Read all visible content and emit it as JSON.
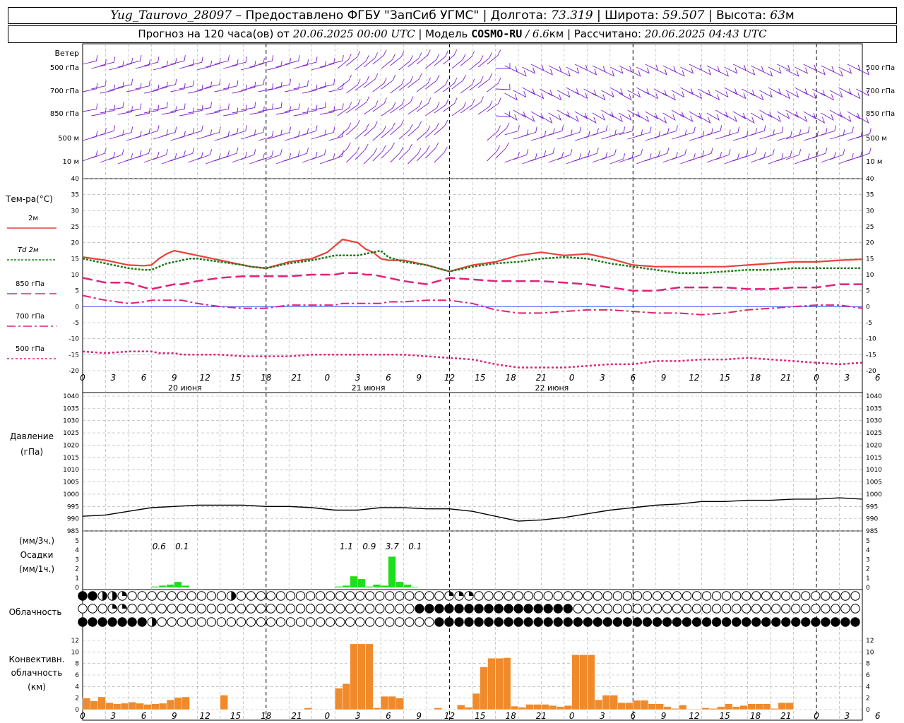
{
  "header": {
    "station": "Yug_Taurovo_28097",
    "provider": " – Предоставлено ФГБУ \"ЗапСиб УГМС\" | ",
    "lon_label": "Долгота: ",
    "lon": "73.319",
    "lat_label": " | Широта: ",
    "lat": "59.507",
    "alt_label": " | Высота: ",
    "alt": "63",
    "alt_unit": "м"
  },
  "subheader": {
    "forecast_label": "Прогноз на 120 часа(ов) от ",
    "forecast_from": "20.06.2025 00:00 UTC",
    "model_label": "  | Модель ",
    "model": "COSMO-RU",
    "resolution": " / 6.6",
    "res_unit": "км",
    "computed_label": " | Рассчитано: ",
    "computed": "20.06.2025 04:43 UTC"
  },
  "wind_panel": {
    "title": "Ветер",
    "levels": [
      "500 гПа",
      "700 гПа",
      "850 гПа",
      "500 м",
      "10  м"
    ],
    "barb_color": "#7a1fd0"
  },
  "temp_panel": {
    "title": "Тем-ра(°C)",
    "legend": [
      {
        "label": "2м",
        "color": "#e8413a",
        "dash": ""
      },
      {
        "label": "Td  2м",
        "color": "#1a7a1a",
        "dash": "3,2"
      },
      {
        "label": "850 гПа",
        "color": "#e0207a",
        "dash": "14,6"
      },
      {
        "label": "700 гПа",
        "color": "#e0207a",
        "dash": "12,4,3,4"
      },
      {
        "label": "500 гПа",
        "color": "#e0207a",
        "dash": "3,3"
      }
    ],
    "yticks": [
      "40",
      "35",
      "30",
      "25",
      "20",
      "15",
      "10",
      "5",
      "0",
      "-5",
      "-10",
      "-15",
      "-20"
    ],
    "xticks": [
      "0",
      "3",
      "6",
      "9",
      "12",
      "15",
      "18",
      "21",
      "0",
      "3",
      "6",
      "9",
      "12",
      "15",
      "18",
      "21",
      "0",
      "3",
      "6",
      "9",
      "12",
      "15",
      "18",
      "21",
      "0",
      "3",
      "6"
    ],
    "days": [
      "20 июня",
      "21 июня",
      "22 июня"
    ]
  },
  "pressure_panel": {
    "title": "Давление",
    "unit": "(гПа)",
    "yticks": [
      "1040",
      "1035",
      "1030",
      "1025",
      "1020",
      "1015",
      "1010",
      "1005",
      "1000",
      "995",
      "990",
      "985"
    ]
  },
  "precip_panel": {
    "unit_3h": "(мм/3ч.)",
    "title": "Осадки",
    "unit_1h": "(мм/1ч.)",
    "yticks": [
      "5",
      "4",
      "3",
      "2",
      "1",
      "0"
    ],
    "totals": [
      {
        "hour": 10,
        "label": "0.6"
      },
      {
        "hour": 13,
        "label": "0.1"
      },
      {
        "hour": 34.5,
        "label": "1.1"
      },
      {
        "hour": 37.5,
        "label": "0.9"
      },
      {
        "hour": 40.5,
        "label": "3.7"
      },
      {
        "hour": 43.5,
        "label": "0.1"
      }
    ],
    "bar_color": "#19e019"
  },
  "cloud_panel": {
    "title": "Облачность",
    "rows": [
      "ffffccccdbbbbbbbbbbbbbbbbbbbbbcbbbbbbbbbbbbbbbbbbbbbbbbbbbbbbbbbbbbbbbbbbcdddddbbbbbbbbbbbbbbbbbbbbbbbbbbbbbbbbbbbbbbbbbbbbbbbbbbbbbbbbbbbbbbbbbbbbbbbbbbbbbbbbbbf",
      "bbbbbbddddbbbbbbbbbbbbbbbbbbbbbbbbbbbbbbbbbbbbbbbbbbbbbbbbbbbbbbbbbbfffffffffffffffffffffffffffffffbbbbbbbbbbbbbbbbbbbbbbbbbbbbbbbbbbbbbbbbbbbbbbbbbbbbbbbbbbf",
      "fffffffffffffcccbbbbbbbbbbbbbbbbbbbbbbbbbbbbbbbbbbbbbbbbbbbbbbbbbbbbbbbffffffffffffffffffffffffffffffffffffffffffffffffffffffffffffffffffffffffffffffffffffffffff"
    ]
  },
  "conv_panel": {
    "title_1": "Конвективн.",
    "title_2": "облачность",
    "unit": "(км)",
    "yticks": [
      "12",
      "10",
      "8",
      "6",
      "4",
      "2",
      "0"
    ],
    "bar_color": "#f08a2a"
  },
  "chart_data": [
    {
      "type": "line",
      "name": "temperature",
      "ylabel": "Тем-ра(°C)",
      "ylim": [
        -20,
        40
      ],
      "x_hours": [
        0,
        3,
        6,
        8,
        9,
        10,
        11,
        12,
        13,
        14,
        15,
        18,
        21,
        22,
        24,
        27,
        30,
        32,
        33,
        34,
        36,
        37,
        38,
        39,
        40,
        42,
        45,
        48,
        51,
        54,
        57,
        60,
        63,
        66,
        69,
        72,
        75,
        78,
        81,
        84,
        87,
        90,
        93,
        96,
        99,
        102
      ],
      "series": [
        {
          "name": "2м",
          "values": [
            15.5,
            14.5,
            13,
            12.8,
            13,
            15,
            16.5,
            17.5,
            17,
            16.5,
            16,
            14.5,
            13,
            12.5,
            12,
            14,
            15,
            17,
            19,
            21,
            20,
            18,
            17,
            15,
            14.5,
            14.5,
            13,
            11,
            13,
            14,
            16,
            17,
            16,
            16.5,
            15,
            13,
            12.5,
            12.5,
            12.5,
            12.5,
            13,
            13.5,
            14,
            14,
            14.5,
            14.8
          ]
        },
        {
          "name": "Td  2м",
          "values": [
            15,
            13.5,
            12,
            11.5,
            11.5,
            12.5,
            13.5,
            14,
            14.5,
            15,
            15,
            14,
            13,
            12.5,
            12,
            13.5,
            14.5,
            15.5,
            16,
            16,
            16,
            16.5,
            17,
            17.5,
            15.5,
            14,
            13,
            11,
            12.5,
            13.5,
            14,
            15,
            15.5,
            15,
            13.5,
            12.5,
            11.5,
            10.5,
            10.5,
            11,
            11.5,
            11.5,
            12,
            12,
            12,
            12
          ]
        },
        {
          "name": "850 гПа",
          "values": [
            9,
            7.5,
            7.5,
            6,
            5.5,
            6,
            6.5,
            7,
            7,
            7.5,
            8,
            9,
            9.5,
            9.5,
            9.5,
            9.5,
            10,
            10,
            10,
            10.5,
            10.5,
            10,
            10,
            9.5,
            9,
            8,
            7,
            9,
            8.5,
            8,
            8,
            8,
            7.5,
            7,
            6,
            5,
            5,
            6,
            6,
            6,
            5.5,
            5.5,
            6,
            6,
            7,
            7
          ]
        },
        {
          "name": "700 гПа",
          "values": [
            3.5,
            2,
            1,
            1.5,
            2,
            2,
            2,
            2,
            2,
            1.5,
            1,
            0,
            -0.5,
            -0.5,
            -0.5,
            0.5,
            0.5,
            0.5,
            0.5,
            1,
            1,
            1,
            1,
            1,
            1.5,
            1.5,
            2,
            2,
            1,
            -1,
            -2,
            -2,
            -1.5,
            -1,
            -1,
            -1.5,
            -2,
            -2,
            -2.5,
            -2,
            -1,
            -0.5,
            0,
            0.5,
            0.5,
            -0.5
          ]
        },
        {
          "name": "500 гПа",
          "values": [
            -14,
            -14.5,
            -14,
            -14,
            -14,
            -14.5,
            -14.5,
            -14.5,
            -15,
            -15,
            -15,
            -15,
            -15.5,
            -15.5,
            -15.5,
            -15.5,
            -15,
            -15,
            -15,
            -15,
            -15,
            -15,
            -15,
            -15,
            -15,
            -15,
            -15.5,
            -16,
            -16.5,
            -18,
            -19,
            -19,
            -19,
            -18.5,
            -18,
            -18,
            -17,
            -17,
            -16.5,
            -16.5,
            -16,
            -16.5,
            -17,
            -17.5,
            -18,
            -17.5
          ]
        }
      ]
    },
    {
      "type": "line",
      "name": "pressure",
      "ylabel": "Давление (гПа)",
      "ylim": [
        985,
        1040
      ],
      "x_hours": [
        0,
        3,
        6,
        9,
        12,
        15,
        18,
        21,
        24,
        27,
        30,
        33,
        36,
        39,
        42,
        45,
        48,
        51,
        54,
        57,
        60,
        63,
        66,
        69,
        72,
        75,
        78,
        81,
        84,
        87,
        90,
        93,
        96,
        99,
        102
      ],
      "values": [
        991,
        991.5,
        993,
        994.5,
        995,
        995.5,
        995.5,
        995.5,
        995,
        995,
        994.5,
        993.5,
        993.5,
        994.5,
        994.5,
        994,
        994,
        993,
        991,
        989,
        989.5,
        990.5,
        992,
        993.5,
        994.5,
        995.5,
        996,
        997,
        997,
        997.5,
        997.5,
        998,
        998,
        998.5,
        998
      ]
    },
    {
      "type": "bar",
      "name": "precipitation",
      "ylabel": "Осадки (мм/1ч.)",
      "ylim": [
        0,
        5
      ],
      "x_hours": [
        9,
        10,
        11,
        12,
        13,
        33,
        34,
        35,
        36,
        37,
        38,
        39,
        40,
        41,
        42,
        43
      ],
      "values": [
        0.1,
        0.2,
        0.3,
        0.6,
        0.2,
        0.1,
        0.2,
        1.2,
        0.9,
        0.1,
        0.3,
        0.2,
        3.3,
        0.6,
        0.3,
        0.05
      ]
    },
    {
      "type": "bar",
      "name": "convective_cloud",
      "ylabel": "Конвективн. облачность (км)",
      "ylim": [
        0,
        12
      ],
      "x_hours": [
        0,
        1,
        2,
        3,
        4,
        5,
        6,
        7,
        8,
        9,
        10,
        11,
        12,
        13,
        18,
        29,
        33,
        34,
        35,
        36,
        37,
        38,
        39,
        40,
        41,
        46,
        49,
        50,
        51,
        52,
        53,
        54,
        55,
        56,
        57,
        58,
        59,
        60,
        61,
        62,
        63,
        64,
        65,
        66,
        67,
        68,
        69,
        70,
        71,
        72,
        73,
        74,
        75,
        76,
        77,
        78,
        79,
        80,
        81,
        82,
        83,
        84,
        85,
        86,
        87,
        88,
        89,
        90,
        91,
        92,
        93,
        94,
        95,
        96,
        97,
        98,
        99,
        100,
        101
      ],
      "values": [
        2,
        1.5,
        2.2,
        1.2,
        1.0,
        1.1,
        1.3,
        1.1,
        0.9,
        1.0,
        1.1,
        1.7,
        2.1,
        2.2,
        2.5,
        0.3,
        3.7,
        4.5,
        11.4,
        11.4,
        11.4,
        0.3,
        2.3,
        2.3,
        2.0,
        0.3,
        0.8,
        0.4,
        2.8,
        7.4,
        8.9,
        8.9,
        9.0,
        0.6,
        0.4,
        0.9,
        0.9,
        0.9,
        0.7,
        0.5,
        0.7,
        9.5,
        9.5,
        9.5,
        1.7,
        2.5,
        2.5,
        1.2,
        1.2,
        1.6,
        1.6,
        1.0,
        1.0,
        0.5,
        0.2,
        0.8,
        0.1,
        0.1,
        0.3,
        0.2,
        0.5,
        1.0,
        0.5,
        0.7,
        1.0,
        1.0,
        1.0,
        0.2,
        1.2,
        1.2
      ]
    }
  ]
}
